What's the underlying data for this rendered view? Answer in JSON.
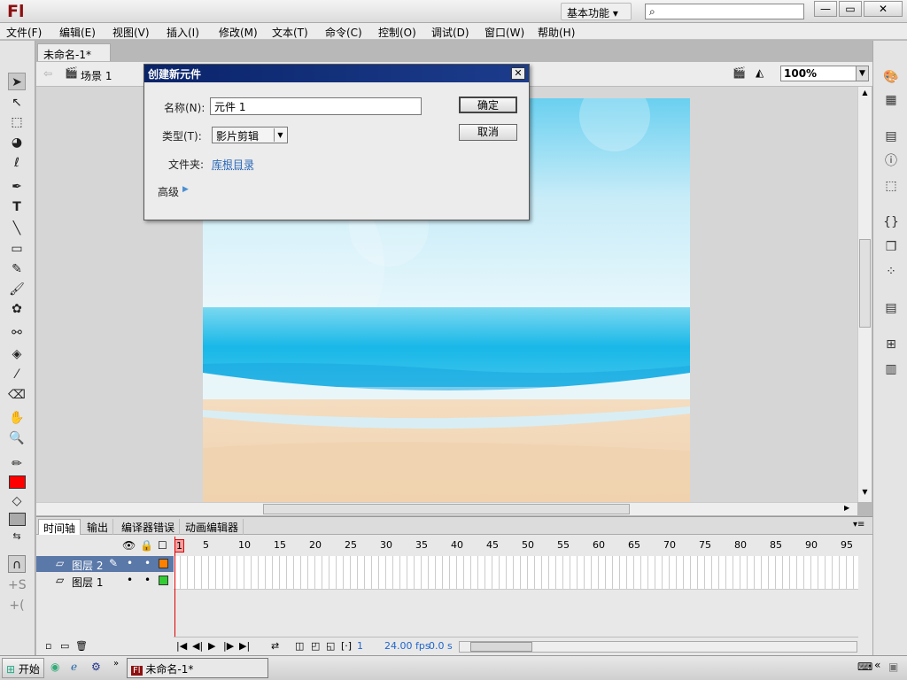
{
  "app": {
    "logo": "Fl",
    "workspace": "基本功能 ▾",
    "search_placeholder": ""
  },
  "window_controls": [
    "—",
    "▭",
    "✕"
  ],
  "menu": [
    "文件(F)",
    "编辑(E)",
    "视图(V)",
    "插入(I)",
    "修改(M)",
    "文本(T)",
    "命令(C)",
    "控制(O)",
    "调试(D)",
    "窗口(W)",
    "帮助(H)"
  ],
  "document": {
    "tab": "未命名-1*",
    "scene": "场景 1",
    "zoom": "100%"
  },
  "dialog": {
    "title": "创建新元件",
    "name_label": "名称(N):",
    "name_value": "元件 1",
    "type_label": "类型(T):",
    "type_value": "影片剪辑",
    "folder_label": "文件夹:",
    "folder_value": "库根目录",
    "advanced": "高级",
    "ok": "确定",
    "cancel": "取消"
  },
  "timeline": {
    "tabs": [
      "时间轴",
      "输出",
      "编译器错误",
      "动画编辑器"
    ],
    "frame_numbers": [
      "1",
      "5",
      "10",
      "15",
      "20",
      "25",
      "30",
      "35",
      "40",
      "45",
      "50",
      "55",
      "60",
      "65",
      "70",
      "75",
      "80",
      "85",
      "90",
      "95"
    ],
    "layers": [
      {
        "name": "图层 2",
        "color": "#ff8000"
      },
      {
        "name": "图层 1",
        "color": "#33cc33"
      }
    ],
    "status": {
      "frame": "1",
      "fps": "24.00 fps",
      "time": "0.0 s"
    }
  },
  "taskbar": {
    "start": "开始",
    "window": "未命名-1*"
  },
  "colors": {
    "stroke": "#000000",
    "fill": "#ff0000"
  }
}
